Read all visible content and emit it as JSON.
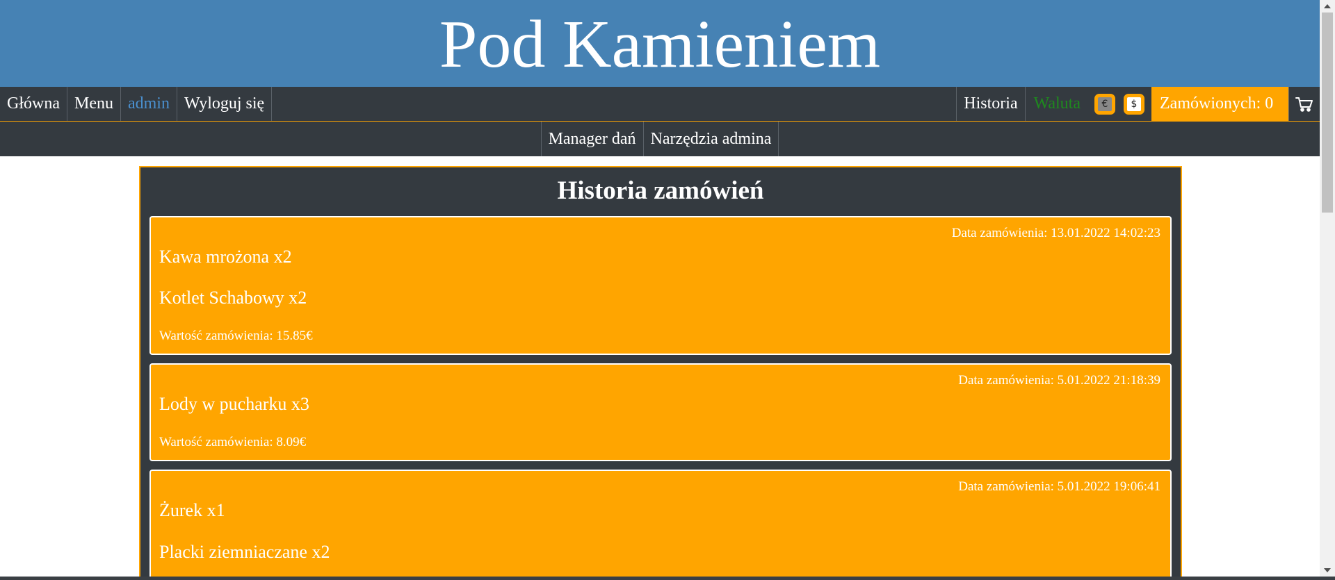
{
  "site": {
    "title": "Pod Kamieniem"
  },
  "topnav": {
    "home": "Główna",
    "menu": "Menu",
    "user": "admin",
    "logout": "Wyloguj się",
    "history": "Historia",
    "currency_label": "Waluta",
    "currency_eur": "€",
    "currency_usd": "$",
    "orders_count": "Zamówionych: 0",
    "cart_icon": "cart-icon"
  },
  "subnav": {
    "dish_manager": "Manager dań",
    "admin_tools": "Narzędzia admina"
  },
  "history": {
    "title": "Historia zamówień",
    "orders": [
      {
        "date": "Data zamówienia: 13.01.2022 14:02:23",
        "items": [
          "Kawa mrożona x2",
          "Kotlet Schabowy x2"
        ],
        "total": "Wartość zamówienia: 15.85€"
      },
      {
        "date": "Data zamówienia: 5.01.2022 21:18:39",
        "items": [
          "Lody w pucharku x3"
        ],
        "total": "Wartość zamówienia: 8.09€"
      },
      {
        "date": "Data zamówienia: 5.01.2022 19:06:41",
        "items": [
          "Żurek x1",
          "Placki ziemniaczane x2"
        ]
      }
    ]
  },
  "colors": {
    "banner": "#4682b4",
    "nav": "#343a40",
    "accent": "#ffa500",
    "admin_link": "#4a90d0",
    "currency_label": "#1e8a1e"
  }
}
